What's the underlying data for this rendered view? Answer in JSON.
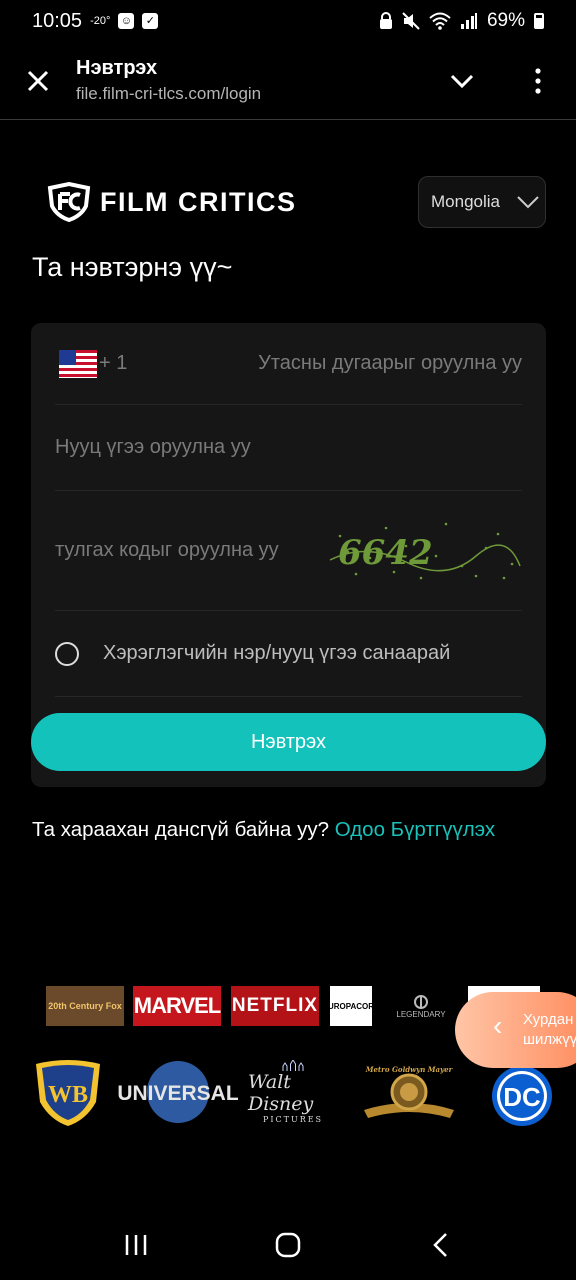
{
  "status_bar": {
    "time": "10:05",
    "temp": "-20°",
    "battery": "69%"
  },
  "browser": {
    "title": "Нэвтрэх",
    "url": "file.film-cri-tlcs.com/login"
  },
  "brand": {
    "name": "FILM CRITICS"
  },
  "language_select": {
    "value": "Mongolia"
  },
  "welcome": "Та нэвтэрнэ үү~",
  "form": {
    "country_code": "+ 1",
    "phone_placeholder": "Утасны дугаарыг оруулна уу",
    "password_placeholder": "Нууц үгээ оруулна уу",
    "captcha_placeholder": "тулгах кодыг оруулна уу",
    "captcha_code": "6642",
    "remember_label": "Хэрэглэгчийн нэр/нууц үгээ санаарай",
    "login_button": "Нэвтрэх"
  },
  "register": {
    "prompt": "Та хараахан дансгүй байна уу?",
    "link": "Одоо Бүртгүүлэх"
  },
  "partners": {
    "fox": "20th Century Fox",
    "marvel": "MARVEL",
    "netflix": "NETFLIX",
    "europa": "EUROPACORP",
    "legendary": "LEGENDARY",
    "wb": "WB",
    "universal": "UNIVERSAL",
    "disney_top": "Walt Disney",
    "disney_bottom": "PICTURES",
    "mgm": "Metro Goldwyn Mayer",
    "dc": "DC"
  },
  "quick_button": {
    "line1": "Хурдан",
    "line2": "шилжүү"
  },
  "colors": {
    "accent": "#13c2bb",
    "link": "#19c2ba",
    "card": "#161616"
  }
}
